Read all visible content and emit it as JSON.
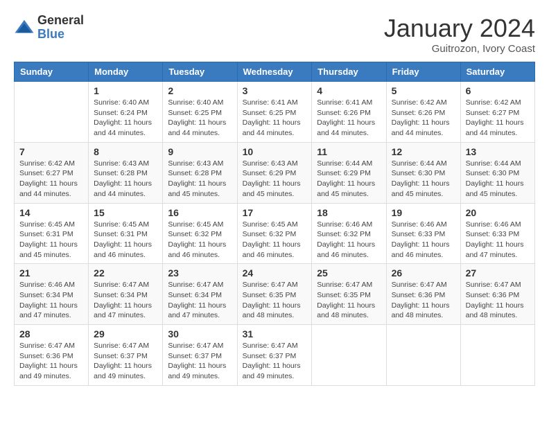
{
  "logo": {
    "general": "General",
    "blue": "Blue"
  },
  "title": "January 2024",
  "location": "Guitrozon, Ivory Coast",
  "weekdays": [
    "Sunday",
    "Monday",
    "Tuesday",
    "Wednesday",
    "Thursday",
    "Friday",
    "Saturday"
  ],
  "weeks": [
    [
      {
        "day": "",
        "info": ""
      },
      {
        "day": "1",
        "info": "Sunrise: 6:40 AM\nSunset: 6:24 PM\nDaylight: 11 hours and 44 minutes."
      },
      {
        "day": "2",
        "info": "Sunrise: 6:40 AM\nSunset: 6:25 PM\nDaylight: 11 hours and 44 minutes."
      },
      {
        "day": "3",
        "info": "Sunrise: 6:41 AM\nSunset: 6:25 PM\nDaylight: 11 hours and 44 minutes."
      },
      {
        "day": "4",
        "info": "Sunrise: 6:41 AM\nSunset: 6:26 PM\nDaylight: 11 hours and 44 minutes."
      },
      {
        "day": "5",
        "info": "Sunrise: 6:42 AM\nSunset: 6:26 PM\nDaylight: 11 hours and 44 minutes."
      },
      {
        "day": "6",
        "info": "Sunrise: 6:42 AM\nSunset: 6:27 PM\nDaylight: 11 hours and 44 minutes."
      }
    ],
    [
      {
        "day": "7",
        "info": "Sunrise: 6:42 AM\nSunset: 6:27 PM\nDaylight: 11 hours and 44 minutes."
      },
      {
        "day": "8",
        "info": "Sunrise: 6:43 AM\nSunset: 6:28 PM\nDaylight: 11 hours and 44 minutes."
      },
      {
        "day": "9",
        "info": "Sunrise: 6:43 AM\nSunset: 6:28 PM\nDaylight: 11 hours and 45 minutes."
      },
      {
        "day": "10",
        "info": "Sunrise: 6:43 AM\nSunset: 6:29 PM\nDaylight: 11 hours and 45 minutes."
      },
      {
        "day": "11",
        "info": "Sunrise: 6:44 AM\nSunset: 6:29 PM\nDaylight: 11 hours and 45 minutes."
      },
      {
        "day": "12",
        "info": "Sunrise: 6:44 AM\nSunset: 6:30 PM\nDaylight: 11 hours and 45 minutes."
      },
      {
        "day": "13",
        "info": "Sunrise: 6:44 AM\nSunset: 6:30 PM\nDaylight: 11 hours and 45 minutes."
      }
    ],
    [
      {
        "day": "14",
        "info": "Sunrise: 6:45 AM\nSunset: 6:31 PM\nDaylight: 11 hours and 45 minutes."
      },
      {
        "day": "15",
        "info": "Sunrise: 6:45 AM\nSunset: 6:31 PM\nDaylight: 11 hours and 46 minutes."
      },
      {
        "day": "16",
        "info": "Sunrise: 6:45 AM\nSunset: 6:32 PM\nDaylight: 11 hours and 46 minutes."
      },
      {
        "day": "17",
        "info": "Sunrise: 6:45 AM\nSunset: 6:32 PM\nDaylight: 11 hours and 46 minutes."
      },
      {
        "day": "18",
        "info": "Sunrise: 6:46 AM\nSunset: 6:32 PM\nDaylight: 11 hours and 46 minutes."
      },
      {
        "day": "19",
        "info": "Sunrise: 6:46 AM\nSunset: 6:33 PM\nDaylight: 11 hours and 46 minutes."
      },
      {
        "day": "20",
        "info": "Sunrise: 6:46 AM\nSunset: 6:33 PM\nDaylight: 11 hours and 47 minutes."
      }
    ],
    [
      {
        "day": "21",
        "info": "Sunrise: 6:46 AM\nSunset: 6:34 PM\nDaylight: 11 hours and 47 minutes."
      },
      {
        "day": "22",
        "info": "Sunrise: 6:47 AM\nSunset: 6:34 PM\nDaylight: 11 hours and 47 minutes."
      },
      {
        "day": "23",
        "info": "Sunrise: 6:47 AM\nSunset: 6:34 PM\nDaylight: 11 hours and 47 minutes."
      },
      {
        "day": "24",
        "info": "Sunrise: 6:47 AM\nSunset: 6:35 PM\nDaylight: 11 hours and 48 minutes."
      },
      {
        "day": "25",
        "info": "Sunrise: 6:47 AM\nSunset: 6:35 PM\nDaylight: 11 hours and 48 minutes."
      },
      {
        "day": "26",
        "info": "Sunrise: 6:47 AM\nSunset: 6:36 PM\nDaylight: 11 hours and 48 minutes."
      },
      {
        "day": "27",
        "info": "Sunrise: 6:47 AM\nSunset: 6:36 PM\nDaylight: 11 hours and 48 minutes."
      }
    ],
    [
      {
        "day": "28",
        "info": "Sunrise: 6:47 AM\nSunset: 6:36 PM\nDaylight: 11 hours and 49 minutes."
      },
      {
        "day": "29",
        "info": "Sunrise: 6:47 AM\nSunset: 6:37 PM\nDaylight: 11 hours and 49 minutes."
      },
      {
        "day": "30",
        "info": "Sunrise: 6:47 AM\nSunset: 6:37 PM\nDaylight: 11 hours and 49 minutes."
      },
      {
        "day": "31",
        "info": "Sunrise: 6:47 AM\nSunset: 6:37 PM\nDaylight: 11 hours and 49 minutes."
      },
      {
        "day": "",
        "info": ""
      },
      {
        "day": "",
        "info": ""
      },
      {
        "day": "",
        "info": ""
      }
    ]
  ]
}
